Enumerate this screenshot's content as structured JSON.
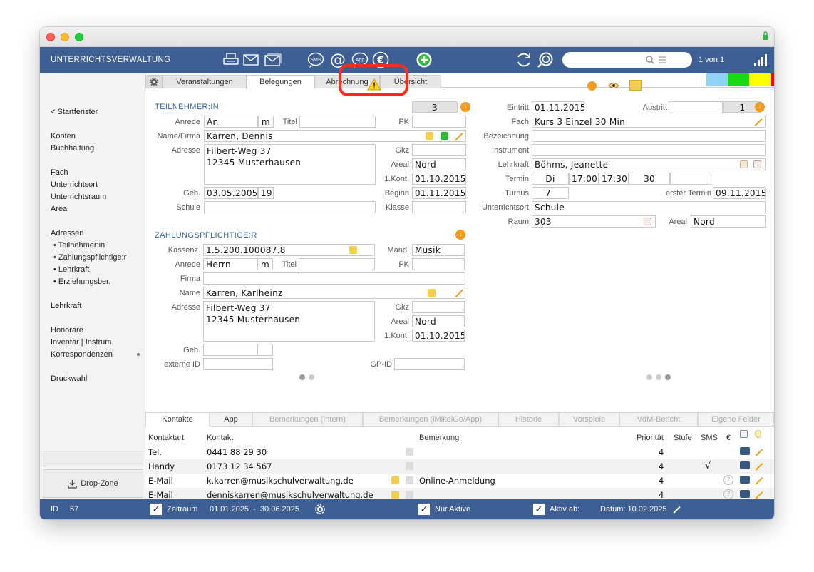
{
  "app": {
    "title": "UNTERRICHTSVERWALTUNG",
    "record_count": "1 von 1"
  },
  "toolbar": {
    "sms_label": "SMS",
    "app_label": "App",
    "euro_label": "€"
  },
  "colors": {
    "toolbar": "#3d5f94",
    "accent_orange": "#f29b1d",
    "highlight_red": "#ff2a1a",
    "swatches": [
      "#8fd2f7",
      "#18d90f",
      "#ffff00",
      "#ff0000"
    ]
  },
  "sidebar": {
    "back": "< Startfenster",
    "items": [
      "Konten",
      "Buchhaltung",
      "Fach",
      "Unterrichtsort",
      "Unterrichtsraum",
      "Areal",
      "Adressen",
      "• Teilnehmer:in",
      "• Zahlungspflichtige:r",
      "• Lehrkraft",
      "• Erziehungsber.",
      "Lehrkraft",
      "Honorare",
      "Inventar | Instrum.",
      "Korrespondenzen",
      "Druckwahl"
    ],
    "drop_zone": "Drop-Zone"
  },
  "tabs": [
    "Veranstaltungen",
    "Belegungen",
    "Abrechnung",
    "Übersicht"
  ],
  "student": {
    "section": "TEILNEHMER:IN",
    "count": "3",
    "labels": {
      "anrede": "Anrede",
      "titel": "Titel",
      "pk": "PK",
      "name": "Name/Firma",
      "adresse": "Adresse",
      "gkz": "Gkz",
      "areal": "Areal",
      "kont": "1.Kont.",
      "geb": "Geb.",
      "beginn": "Beginn",
      "schule": "Schule",
      "klasse": "Klasse"
    },
    "anrede": "An",
    "gender": "m",
    "name": "Karren, Dennis",
    "address_1": "Filbert-Weg 37",
    "address_2": "12345 Musterhausen",
    "areal": "Nord",
    "kont": "01.10.2015",
    "geb": "03.05.2005",
    "age": "19",
    "beginn": "01.11.2015"
  },
  "payer": {
    "section": "ZAHLUNGSPFLICHTIGE:R",
    "labels": {
      "kassenz": "Kassenz.",
      "mand": "Mand.",
      "anrede": "Anrede",
      "titel": "Titel",
      "pk": "PK",
      "firma": "Firma",
      "name": "Name",
      "adresse": "Adresse",
      "gkz": "Gkz",
      "areal": "Areal",
      "kont": "1.Kont.",
      "geb": "Geb.",
      "ext_id": "externe ID",
      "gp_id": "GP-ID"
    },
    "kassenz": "1.5.200.100087.8",
    "mand": "Musik",
    "anrede": "Herrn",
    "gender": "m",
    "name": "Karren, Karlheinz",
    "address_1": "Filbert-Weg 37",
    "address_2": "12345 Musterhausen",
    "areal": "Nord",
    "kont": "01.10.2015"
  },
  "course": {
    "labels": {
      "eintritt": "Eintritt",
      "austritt": "Austritt",
      "fach": "Fach",
      "bezeichnung": "Bezeichnung",
      "instrument": "Instrument",
      "lehrkraft": "Lehrkraft",
      "termin": "Termin",
      "turnus": "Turnus",
      "erster_termin": "erster Termin",
      "unterrichtsort": "Unterrichtsort",
      "raum": "Raum",
      "areal": "Areal"
    },
    "eintritt": "01.11.2015",
    "austritt_count": "1",
    "fach": "Kurs 3 Einzel 30 Min",
    "lehrkraft": "Böhms, Jeanette",
    "day": "Di",
    "start": "17:00",
    "end": "17:30",
    "duration": "30",
    "turnus": "7",
    "erster_termin": "09.11.2015",
    "unterrichtsort": "Schule",
    "raum": "303",
    "areal": "Nord"
  },
  "bottom_tabs": [
    "Kontakte",
    "App",
    "Bemerkungen (Intern)",
    "Bemerkungen (iMikelGo/App)",
    "Historie",
    "Vorspiele",
    "VdM-Bericht",
    "Eigene Felder"
  ],
  "contacts": {
    "headers": {
      "kontaktart": "Kontaktart",
      "kontakt": "Kontakt",
      "bemerkung": "Bemerkung",
      "prioritaet": "Priorität",
      "stufe": "Stufe",
      "sms": "SMS",
      "euro": "€"
    },
    "rows": [
      {
        "type": "Tel.",
        "value": "0441 88 29 30",
        "note": "",
        "priority": "4",
        "sms": ""
      },
      {
        "type": "Handy",
        "value": "0173 12 34 567",
        "note": "",
        "priority": "4",
        "sms": "√"
      },
      {
        "type": "E-Mail",
        "value": "k.karren@musikschulverwaltung.de",
        "note": "Online-Anmeldung",
        "priority": "4",
        "sms": "?"
      },
      {
        "type": "E-Mail",
        "value": "denniskarren@musikschulverwaltung.de",
        "note": "",
        "priority": "4",
        "sms": "?"
      }
    ]
  },
  "status": {
    "id_label": "ID",
    "id": "57",
    "zeitraum_label": "Zeitraum",
    "zeitraum": "01.01.2025  -  30.06.2025",
    "nur_aktive": "Nur Aktive",
    "aktiv_ab": "Aktiv ab:",
    "datum": "Datum: 10.02.2025"
  }
}
